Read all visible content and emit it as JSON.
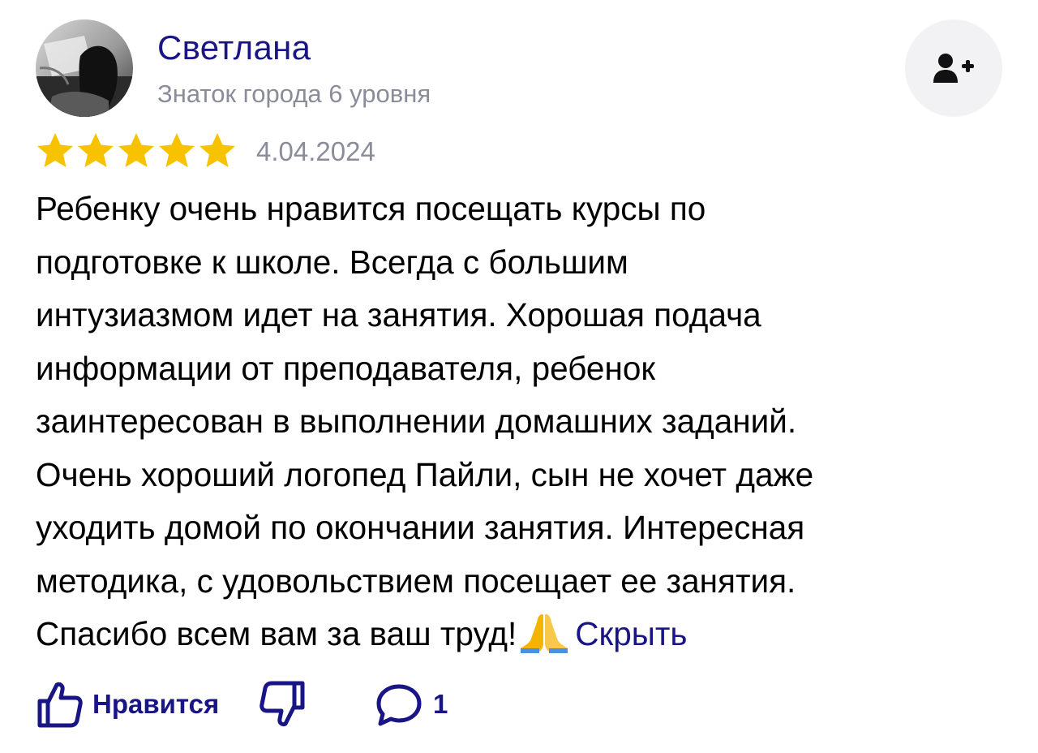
{
  "author": {
    "name": "Светлана",
    "level": "Знаток города 6 уровня"
  },
  "rating": {
    "stars": 5,
    "max": 5,
    "color": "#f7c300"
  },
  "date": "4.04.2024",
  "review": {
    "lines": [
      "Ребенку очень нравится посещать курсы по",
      "подготовке к школе. Всегда с большим",
      "интузиазмом идет на занятия. Хорошая подача",
      "информации от преподавателя, ребенок",
      "заинтересован в выполнении домашних заданий.",
      "Очень хороший логопед Пайли, сын не хочет даже",
      "уходить домой по окончании занятия. Интересная",
      "методика, с удовольствием посещает ее занятия.",
      "Спасибо всем вам за ваш труд!"
    ],
    "emoji": "folded-hands-emoji",
    "hide_label": "Скрыть"
  },
  "actions": {
    "like_label": "Нравится",
    "comments_count": "1"
  },
  "colors": {
    "accent": "#1a1585",
    "muted": "#8a8d99",
    "button_bg": "#f2f2f4"
  }
}
